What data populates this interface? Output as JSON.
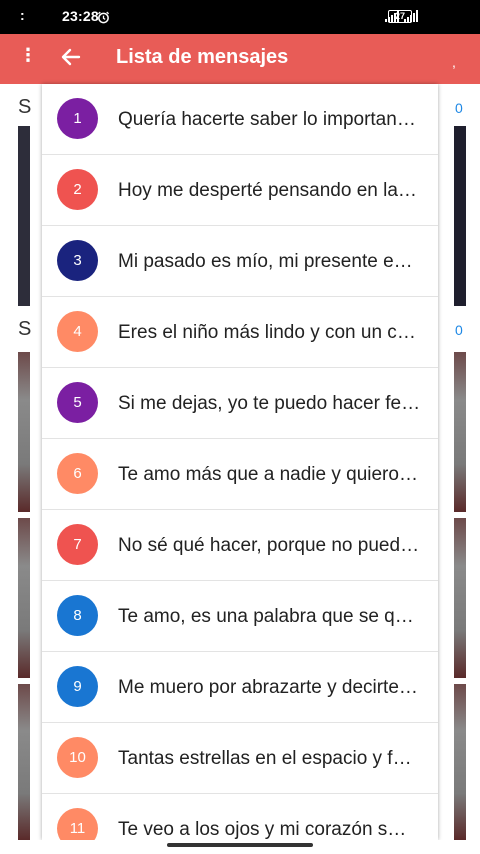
{
  "status_bar": {
    "left_dots": ":",
    "time": "23:28",
    "alarm_icon": "alarm-clock-icon",
    "battery": "27"
  },
  "app_bar": {
    "menu": "⋮",
    "back_icon": "arrow-left-icon",
    "title": "Lista de mensajes",
    "trailing": ","
  },
  "background": {
    "left_letters": [
      "S",
      "S"
    ],
    "right_counts": [
      "0",
      "0"
    ]
  },
  "messages": [
    {
      "number": "1",
      "text": "Quería hacerte saber lo importante…",
      "color": "#7b1fa2"
    },
    {
      "number": "2",
      "text": "Hoy me desperté pensando en la…",
      "color": "#ef5350"
    },
    {
      "number": "3",
      "text": "Mi pasado es mío, mi presente es…",
      "color": "#1a237e"
    },
    {
      "number": "4",
      "text": "Eres el niño más lindo y con un cor…",
      "color": "#ff8a65"
    },
    {
      "number": "5",
      "text": "Si me dejas, yo te puedo hacer feliz…",
      "color": "#7b1fa2"
    },
    {
      "number": "6",
      "text": "Te amo más que a nadie y quiero…",
      "color": "#ff8a65"
    },
    {
      "number": "7",
      "text": "No sé qué hacer, porque no puedo…",
      "color": "#ef5350"
    },
    {
      "number": "8",
      "text": "Te amo, es una palabra que se que…",
      "color": "#1976d2"
    },
    {
      "number": "9",
      "text": "Me muero por abrazarte y decirte…",
      "color": "#1976d2"
    },
    {
      "number": "10",
      "text": "Tantas estrellas en el espacio y f…",
      "color": "#ff8a65"
    },
    {
      "number": "11",
      "text": "Te veo a los ojos y mi corazón s…",
      "color": "#ff8a65"
    }
  ]
}
